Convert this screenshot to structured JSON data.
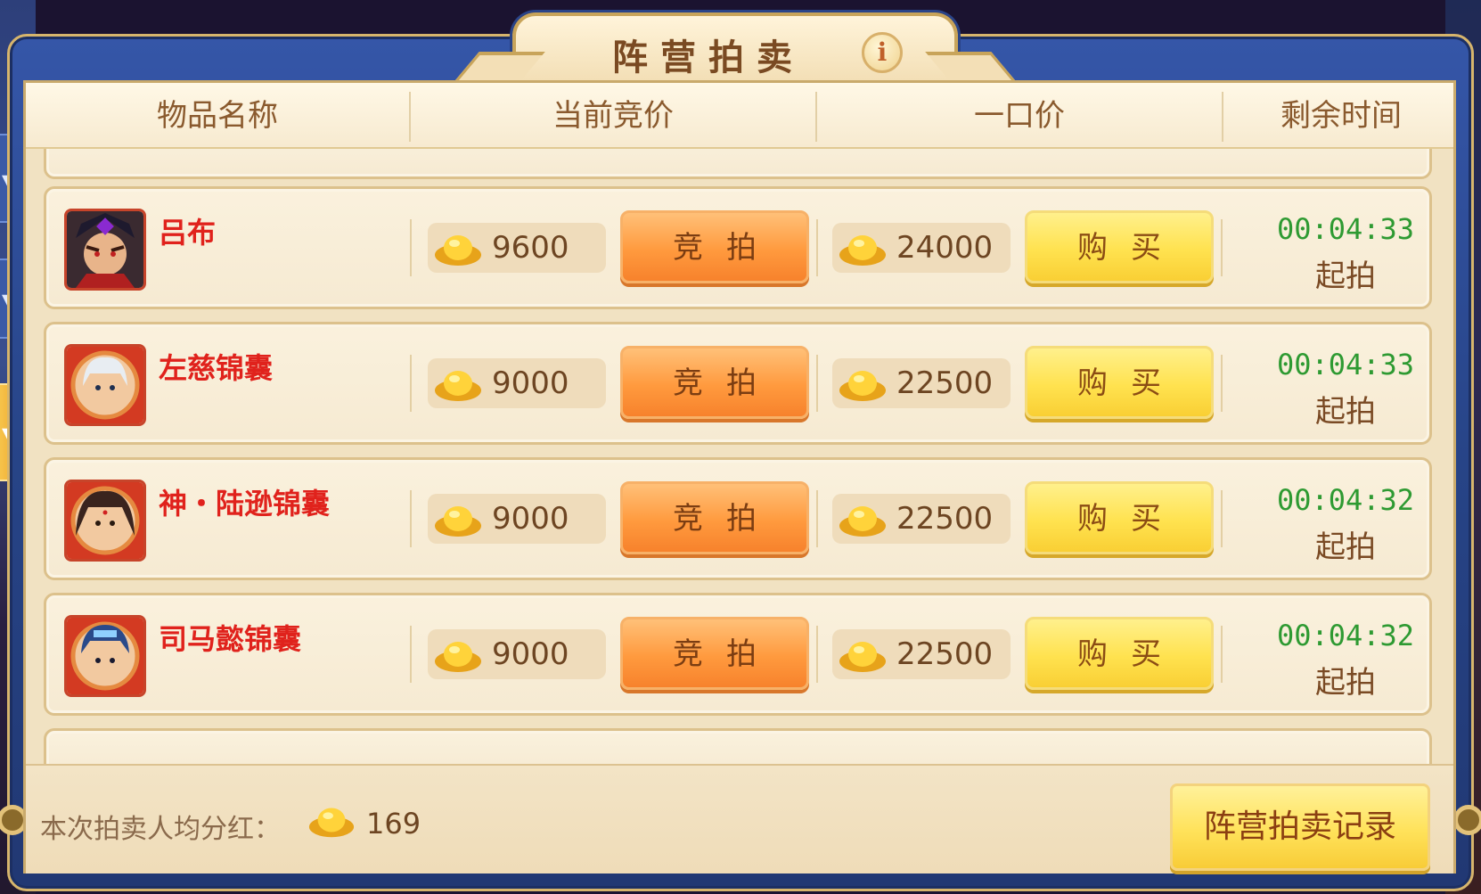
{
  "title": "阵营拍卖",
  "info_icon": "i",
  "columns": {
    "name": "物品名称",
    "current_bid": "当前竞价",
    "buyout": "一口价",
    "time_left": "剩余时间"
  },
  "items": [
    {
      "name": "吕布",
      "avatar": "lvbu-portrait-icon",
      "bid": "9600",
      "bid_label": "竞拍",
      "buyout": "24000",
      "buy_label": "购买",
      "time": "00:04:33",
      "status": "起拍"
    },
    {
      "name": "左慈锦囊",
      "avatar": "zuoci-portrait-icon",
      "bid": "9000",
      "bid_label": "竞拍",
      "buyout": "22500",
      "buy_label": "购买",
      "time": "00:04:33",
      "status": "起拍"
    },
    {
      "name": "神・陆逊锦囊",
      "avatar": "luxun-portrait-icon",
      "bid": "9000",
      "bid_label": "竞拍",
      "buyout": "22500",
      "buy_label": "购买",
      "time": "00:04:32",
      "status": "起拍"
    },
    {
      "name": "司马懿锦囊",
      "avatar": "simayi-portrait-icon",
      "bid": "9000",
      "bid_label": "竞拍",
      "buyout": "22500",
      "buy_label": "购买",
      "time": "00:04:32",
      "status": "起拍"
    }
  ],
  "footer": {
    "dividend_label": "本次拍卖人均分红：",
    "dividend_value": "169",
    "record_button": "阵营拍卖记录"
  },
  "colors": {
    "item_name": "#e0221c",
    "timer": "#2e9a32",
    "bid_button": "#ff9a3e",
    "buy_button": "#ffe24f"
  }
}
